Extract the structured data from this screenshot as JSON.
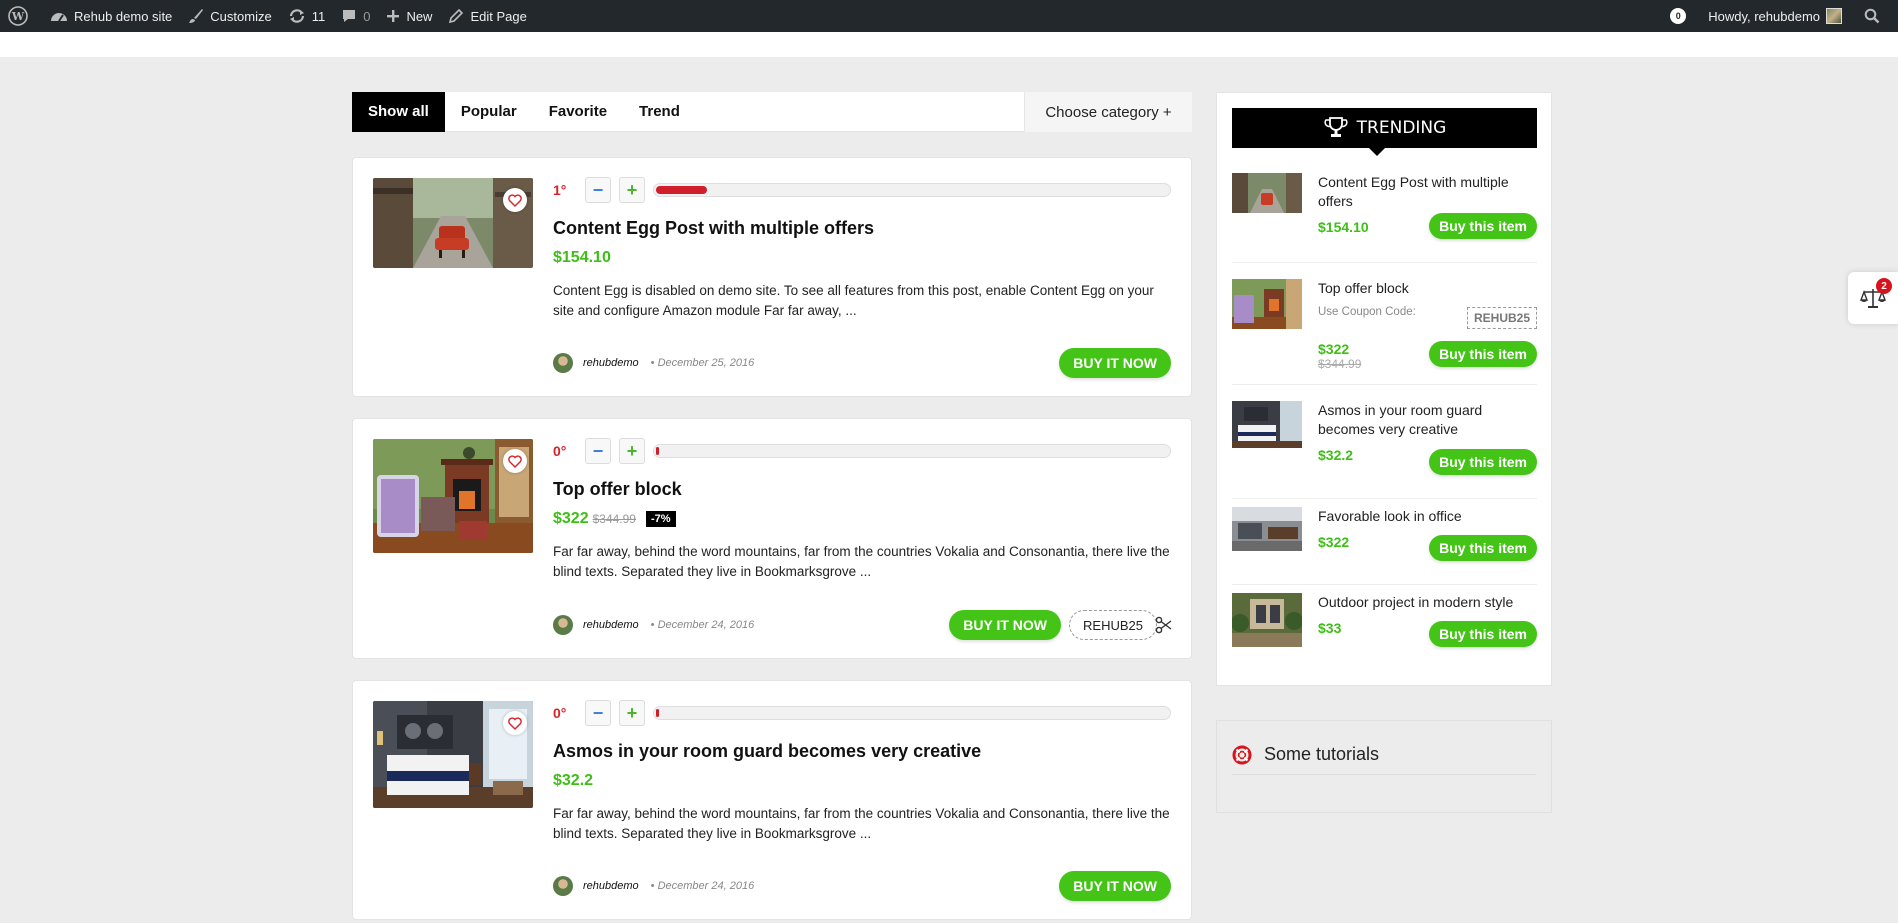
{
  "adminbar": {
    "site_name": "Rehub demo site",
    "customize": "Customize",
    "updates": "11",
    "comments": "0",
    "new": "New",
    "edit_page": "Edit Page",
    "notifications": "0",
    "howdy": "Howdy, rehubdemo"
  },
  "tabs": {
    "show_all": "Show all",
    "popular": "Popular",
    "favorite": "Favorite",
    "trend": "Trend",
    "choose_category": "Choose category +"
  },
  "posts": [
    {
      "hot": "1°",
      "hot_level": 0.1,
      "title": "Content Egg Post with multiple offers",
      "price": "$154.10",
      "excerpt": "Content Egg is disabled on demo site. To see all features from this post, enable Content Egg on your site and configure Amazon module Far far away, ...",
      "author": "rehubdemo",
      "date": "December 25, 2016",
      "buy_label": "BUY IT NOW"
    },
    {
      "hot": "0°",
      "hot_level": 0.0,
      "title": "Top offer block",
      "price": "$322",
      "old_price": "$344.99",
      "discount": "-7%",
      "excerpt": "Far far away, behind the word mountains, far from the countries Vokalia and Consonantia, there live the blind texts. Separated they live in Bookmarksgrove ...",
      "author": "rehubdemo",
      "date": "December 24, 2016",
      "buy_label": "BUY IT NOW",
      "coupon": "REHUB25"
    },
    {
      "hot": "0°",
      "hot_level": 0.0,
      "title": "Asmos in your room guard becomes very creative",
      "price": "$32.2",
      "excerpt": "Far far away, behind the word mountains, far from the countries Vokalia and Consonantia, there live the blind texts. Separated they live in Bookmarksgrove ...",
      "author": "rehubdemo",
      "date": "December 24, 2016",
      "buy_label": "BUY IT NOW"
    }
  ],
  "trending": {
    "heading": "TRENDING",
    "items": [
      {
        "title": "Content Egg Post with multiple offers",
        "price": "$154.10",
        "button": "Buy this item"
      },
      {
        "title": "Top offer block",
        "coupon_label": "Use Coupon Code:",
        "coupon": "REHUB25",
        "price": "$322",
        "old_price": "$344.99",
        "button": "Buy this item"
      },
      {
        "title": "Asmos in your room guard becomes very creative",
        "price": "$32.2",
        "button": "Buy this item"
      },
      {
        "title": "Favorable look in office",
        "price": "$322",
        "button": "Buy this item"
      },
      {
        "title": "Outdoor project in modern style",
        "price": "$33",
        "button": "Buy this item"
      }
    ]
  },
  "tutorials": {
    "heading": "Some tutorials"
  },
  "compare": {
    "count": "2"
  },
  "colors": {
    "accent_green": "#44c416",
    "hot_red": "#d01f2a",
    "admin_bar": "#23282d"
  }
}
